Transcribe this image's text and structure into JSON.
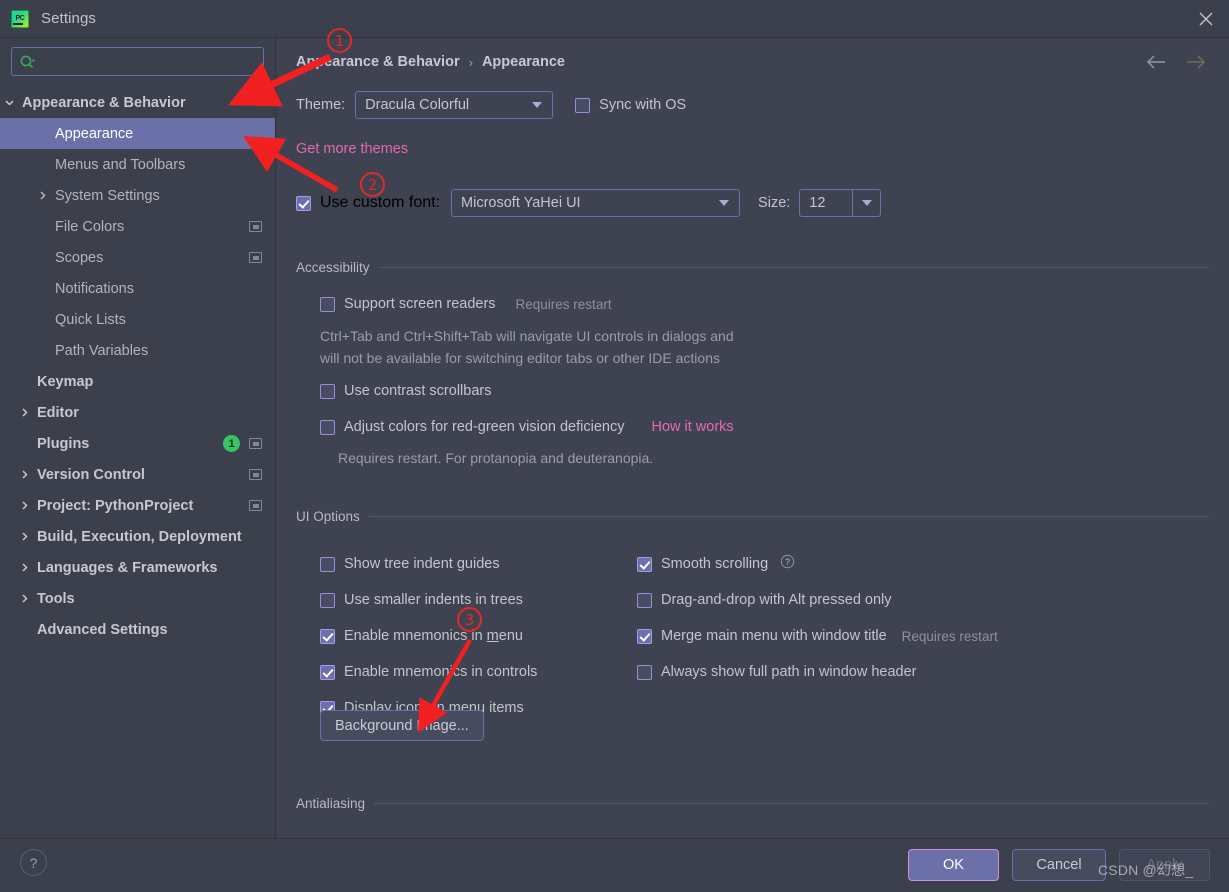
{
  "window": {
    "title": "Settings",
    "app_icon": "pycharm-icon",
    "close_icon": "close-icon"
  },
  "sidebar": {
    "search": {
      "placeholder": "",
      "value": "",
      "icon": "search-icon"
    },
    "items": [
      {
        "label": "Appearance & Behavior",
        "indent": 22,
        "arrow": "chevron-down",
        "bold": true,
        "selected": false
      },
      {
        "label": "Appearance",
        "indent": 55,
        "arrow": "",
        "bold": false,
        "selected": true
      },
      {
        "label": "Menus and Toolbars",
        "indent": 55,
        "arrow": "",
        "bold": false,
        "selected": false
      },
      {
        "label": "System Settings",
        "indent": 55,
        "arrow": "chevron-right",
        "bold": false,
        "selected": false
      },
      {
        "label": "File Colors",
        "indent": 55,
        "arrow": "",
        "bold": false,
        "selected": false,
        "monitor": true
      },
      {
        "label": "Scopes",
        "indent": 55,
        "arrow": "",
        "bold": false,
        "selected": false,
        "monitor": true
      },
      {
        "label": "Notifications",
        "indent": 55,
        "arrow": "",
        "bold": false,
        "selected": false
      },
      {
        "label": "Quick Lists",
        "indent": 55,
        "arrow": "",
        "bold": false,
        "selected": false
      },
      {
        "label": "Path Variables",
        "indent": 55,
        "arrow": "",
        "bold": false,
        "selected": false
      },
      {
        "label": "Keymap",
        "indent": 37,
        "arrow": "",
        "bold": true,
        "selected": false
      },
      {
        "label": "Editor",
        "indent": 37,
        "arrow": "chevron-right",
        "bold": true,
        "selected": false
      },
      {
        "label": "Plugins",
        "indent": 37,
        "arrow": "",
        "bold": true,
        "selected": false,
        "badge": "1",
        "monitor": true
      },
      {
        "label": "Version Control",
        "indent": 37,
        "arrow": "chevron-right",
        "bold": true,
        "selected": false,
        "monitor": true
      },
      {
        "label": "Project: PythonProject",
        "indent": 37,
        "arrow": "chevron-right",
        "bold": true,
        "selected": false,
        "monitor": true
      },
      {
        "label": "Build, Execution, Deployment",
        "indent": 37,
        "arrow": "chevron-right",
        "bold": true,
        "selected": false
      },
      {
        "label": "Languages & Frameworks",
        "indent": 37,
        "arrow": "chevron-right",
        "bold": true,
        "selected": false
      },
      {
        "label": "Tools",
        "indent": 37,
        "arrow": "chevron-right",
        "bold": true,
        "selected": false
      },
      {
        "label": "Advanced Settings",
        "indent": 37,
        "arrow": "",
        "bold": true,
        "selected": false
      }
    ]
  },
  "main": {
    "breadcrumb": {
      "root": "Appearance & Behavior",
      "separator": "›",
      "current": "Appearance"
    },
    "nav": {
      "back_icon": "arrow-left-icon",
      "forward_icon": "arrow-right-icon"
    },
    "theme": {
      "label": "Theme:",
      "value": "Dracula Colorful",
      "sync_label": "Sync with OS",
      "sync_checked": false,
      "more_themes_link": "Get more themes"
    },
    "font": {
      "use_custom_label": "Use custom font:",
      "use_custom_checked": true,
      "family": "Microsoft YaHei UI",
      "size_label": "Size:",
      "size_value": "12"
    },
    "accessibility": {
      "title": "Accessibility",
      "screen_readers": {
        "label": "Support screen readers",
        "hint": "Requires restart",
        "checked": false
      },
      "screen_readers_desc_line1": "Ctrl+Tab and Ctrl+Shift+Tab will navigate UI controls in dialogs and",
      "screen_readers_desc_line2": "will not be available for switching editor tabs or other IDE actions",
      "contrast_scrollbars": {
        "label": "Use contrast scrollbars",
        "checked": false
      },
      "adjust_colors": {
        "label": "Adjust colors for red-green vision deficiency",
        "link": "How it works",
        "checked": false
      },
      "adjust_colors_desc": "Requires restart. For protanopia and deuteranopia."
    },
    "ui_options": {
      "title": "UI Options",
      "left": [
        {
          "label": "Show tree indent guides",
          "checked": false
        },
        {
          "label": "Use smaller indents in trees",
          "checked": false
        },
        {
          "label": "Enable mnemonics in menu",
          "checked": true
        },
        {
          "label": "Enable mnemonics in controls",
          "checked": true
        },
        {
          "label": "Display icons in menu items",
          "checked": true
        }
      ],
      "right": [
        {
          "label": "Smooth scrolling",
          "checked": true,
          "help": "?"
        },
        {
          "label": "Drag-and-drop with Alt pressed only",
          "checked": false
        },
        {
          "label": "Merge main menu with window title",
          "checked": true,
          "hint": "Requires restart"
        },
        {
          "label": "Always show full path in window header",
          "checked": false
        }
      ],
      "background_image_button": "Background Image..."
    },
    "antialiasing": {
      "title": "Antialiasing"
    }
  },
  "footer": {
    "help_icon": "question-mark-icon",
    "ok": "OK",
    "cancel": "Cancel",
    "apply": "Apply"
  },
  "annotations": {
    "markers": [
      "①",
      "②",
      "③"
    ],
    "watermark": "CSDN @幻想_"
  },
  "colors": {
    "accent": "#6b70a8",
    "link": "#e06ab0",
    "badge": "#37c461",
    "annotation": "#e02a2a",
    "panel_bg": "#3f4250",
    "sidebar_bg": "#3c3f4c"
  }
}
